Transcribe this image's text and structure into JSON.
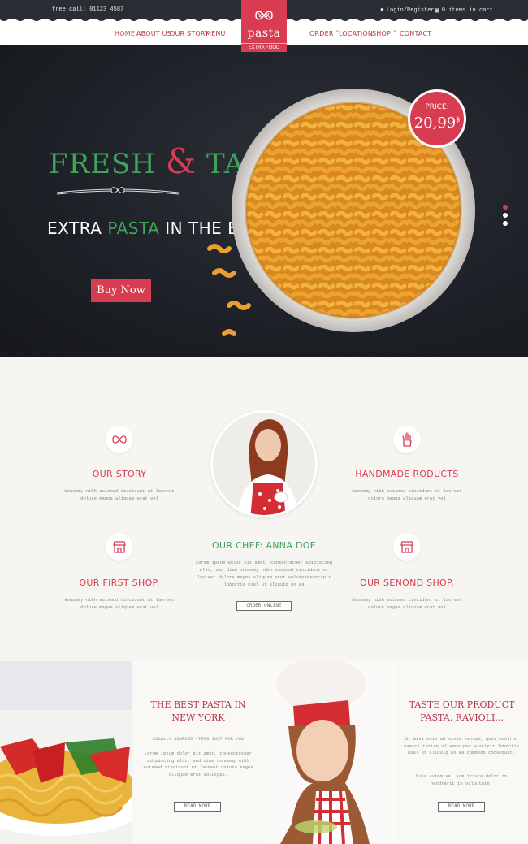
{
  "topbar": {
    "phone": "free call: 01123 4587",
    "login": "Login/Register",
    "cart": "0 items in cart"
  },
  "nav": {
    "home": "HOME",
    "about": "ABOUT US",
    "story": "OUR STORY",
    "menu": "MENU",
    "order": "ORDER",
    "location": "LOCATION",
    "shop": "SHOP",
    "contact": "CONTACT"
  },
  "logo": {
    "name": "pasta",
    "sub": "EXTRA FOOD"
  },
  "hero": {
    "fresh": "FRESH",
    "amp": "&",
    "taste": "TASTE",
    "extra_pre": "EXTRA ",
    "extra_green": "PASTA",
    "extra_post": " IN THE BOX",
    "buy": "Buy Now",
    "price_label": "PRICE:",
    "price_value": "20,99",
    "price_currency": "$",
    "slides": 3,
    "active_slide": 1
  },
  "features": {
    "story": {
      "title": "OUR STORY",
      "text": "Nonummy nibh euismod tincidunt ut laoreet dolore magna aliquam erat vol",
      "icon": "pasta-bow-icon"
    },
    "handmade": {
      "title": "HANDMADE RODUCTS",
      "text": "Nonummy nibh euismod tincidunt ut laoreet dolore magna aliquam erat vol",
      "icon": "hand-icon"
    },
    "first_shop": {
      "title": "OUR FIRST SHOP.",
      "text": "Nonummy nibh euismod tincidunt ut laoreet dolore magna aliquam erat vol",
      "icon": "shop-icon"
    },
    "second_shop": {
      "title": "OUR SENOND SHOP.",
      "text": "Nonummy nibh euismod tincidunt ut laoreet dolore magna aliquam erat vol",
      "icon": "shop-icon"
    },
    "chef": {
      "title": "OUR CHEF: ANNA DOE",
      "text": "Lorem ipsum dolor sit amet, consectetuer adipiscing elit, sed diam nonummy nibh euismod tincidunt ut laoreet dolore magna aliquam erat volutpatsuscipit lobortis nisl ut aliquip ex ea",
      "button": "ORDER ONLINE"
    }
  },
  "bottom": {
    "left": {
      "title": "THE BEST PASTA IN NEW YORK",
      "subtitle": "LOCALLY SOURCED ITEMS JUST FOR YOU",
      "text": "Lorem ipsum dolor sit amet, consectetuer adipiscing elit, sed diam nonummy nibh euismod tincidunt ut laoreet dolore magna aliquam erat volutpat.",
      "button": "READ MORE"
    },
    "right": {
      "title": "TASTE OUR PRODUCT PASTA, RAVIOLI...",
      "text1": "Ut wisi enim ad minim veniam, quis nostrud exerci tation ullamcorper suscipit lobortis nisl ut aliquip ex ea commodo consequat.",
      "text2": "Duis autem vel eum iriure dolor in hendrerit in vulputate.",
      "button": "READ MORE"
    }
  },
  "colors": {
    "accent": "#d73c50",
    "green": "#3fa35a",
    "dark": "#2a2d33"
  }
}
